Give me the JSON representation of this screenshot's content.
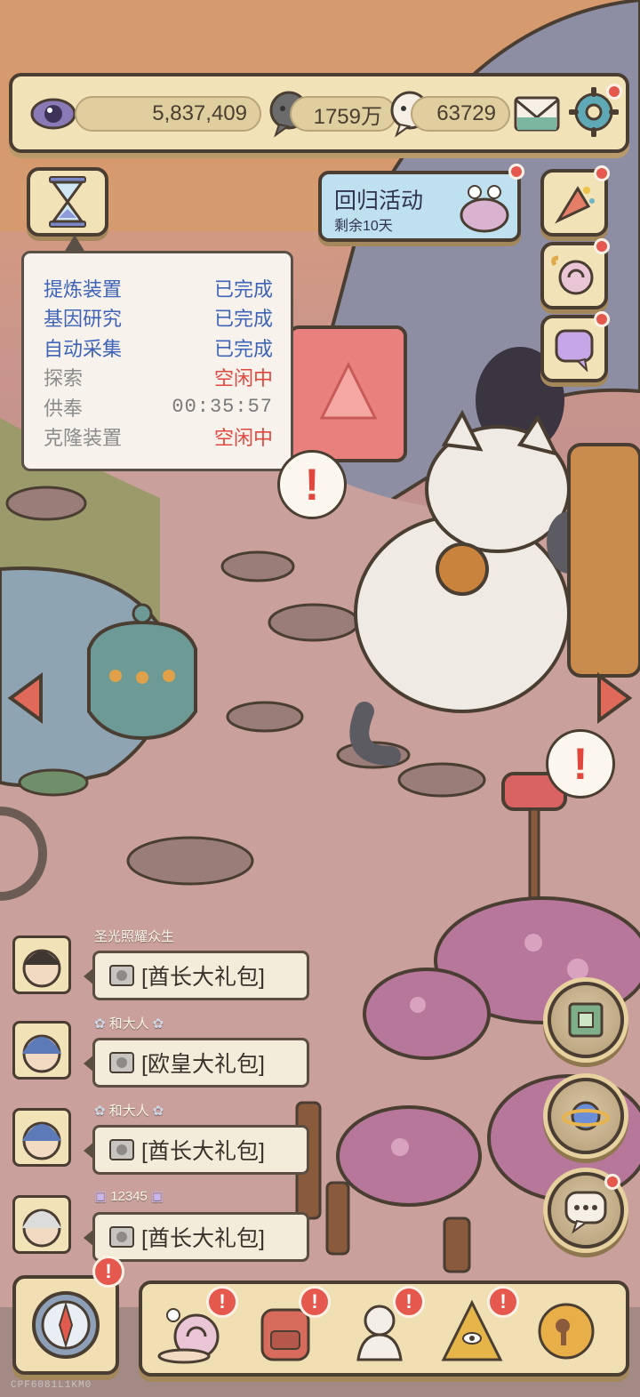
{
  "topbar": {
    "eye_value": "5,837,409",
    "dark_bubble_value": "1759万",
    "light_bubble_value": "63729"
  },
  "event_banner": {
    "title": "回归活动",
    "subtitle": "剩余10天"
  },
  "task_panel": {
    "rows": [
      {
        "name": "提炼装置",
        "status": "已完成",
        "state": "done"
      },
      {
        "name": "基因研究",
        "status": "已完成",
        "state": "done"
      },
      {
        "name": "自动采集",
        "status": "已完成",
        "state": "done"
      },
      {
        "name": "探索",
        "status": "空闲中",
        "state": "idle"
      },
      {
        "name": "供奉",
        "status": "00:35:57",
        "state": "timer"
      },
      {
        "name": "克隆装置",
        "status": "空闲中",
        "state": "idle"
      }
    ]
  },
  "chat": {
    "messages": [
      {
        "sender": "圣光照耀众生",
        "text": "[酋长大礼包]"
      },
      {
        "sender": "和大人",
        "text": "[欧皇大礼包]"
      },
      {
        "sender": "和大人",
        "text": "[酋长大礼包]"
      },
      {
        "sender": "12345",
        "text": "[酋长大礼包]"
      }
    ]
  },
  "alerts": {
    "exclamation": "!"
  },
  "build_id": "CPF6081L1KM0",
  "colors": {
    "panel_bg": "#f1e2b8",
    "outline": "#4a3d32",
    "done_text": "#3e63b8",
    "idle_text": "#e0473e",
    "badge_red": "#e4584e"
  },
  "icons": {
    "topbar": [
      "eye-icon",
      "dark-bubble-icon",
      "light-bubble-icon",
      "mail-icon",
      "gear-icon"
    ],
    "side": [
      "hourglass-icon",
      "party-popper-icon",
      "snail-icon",
      "chat-speech-icon"
    ],
    "bottom": [
      "compass-icon",
      "snail-icon",
      "backpack-icon",
      "bust-statue-icon",
      "pyramid-eye-icon",
      "coin-key-icon"
    ],
    "right_round": [
      "machine-icon",
      "planet-icon",
      "chat-icon"
    ]
  }
}
